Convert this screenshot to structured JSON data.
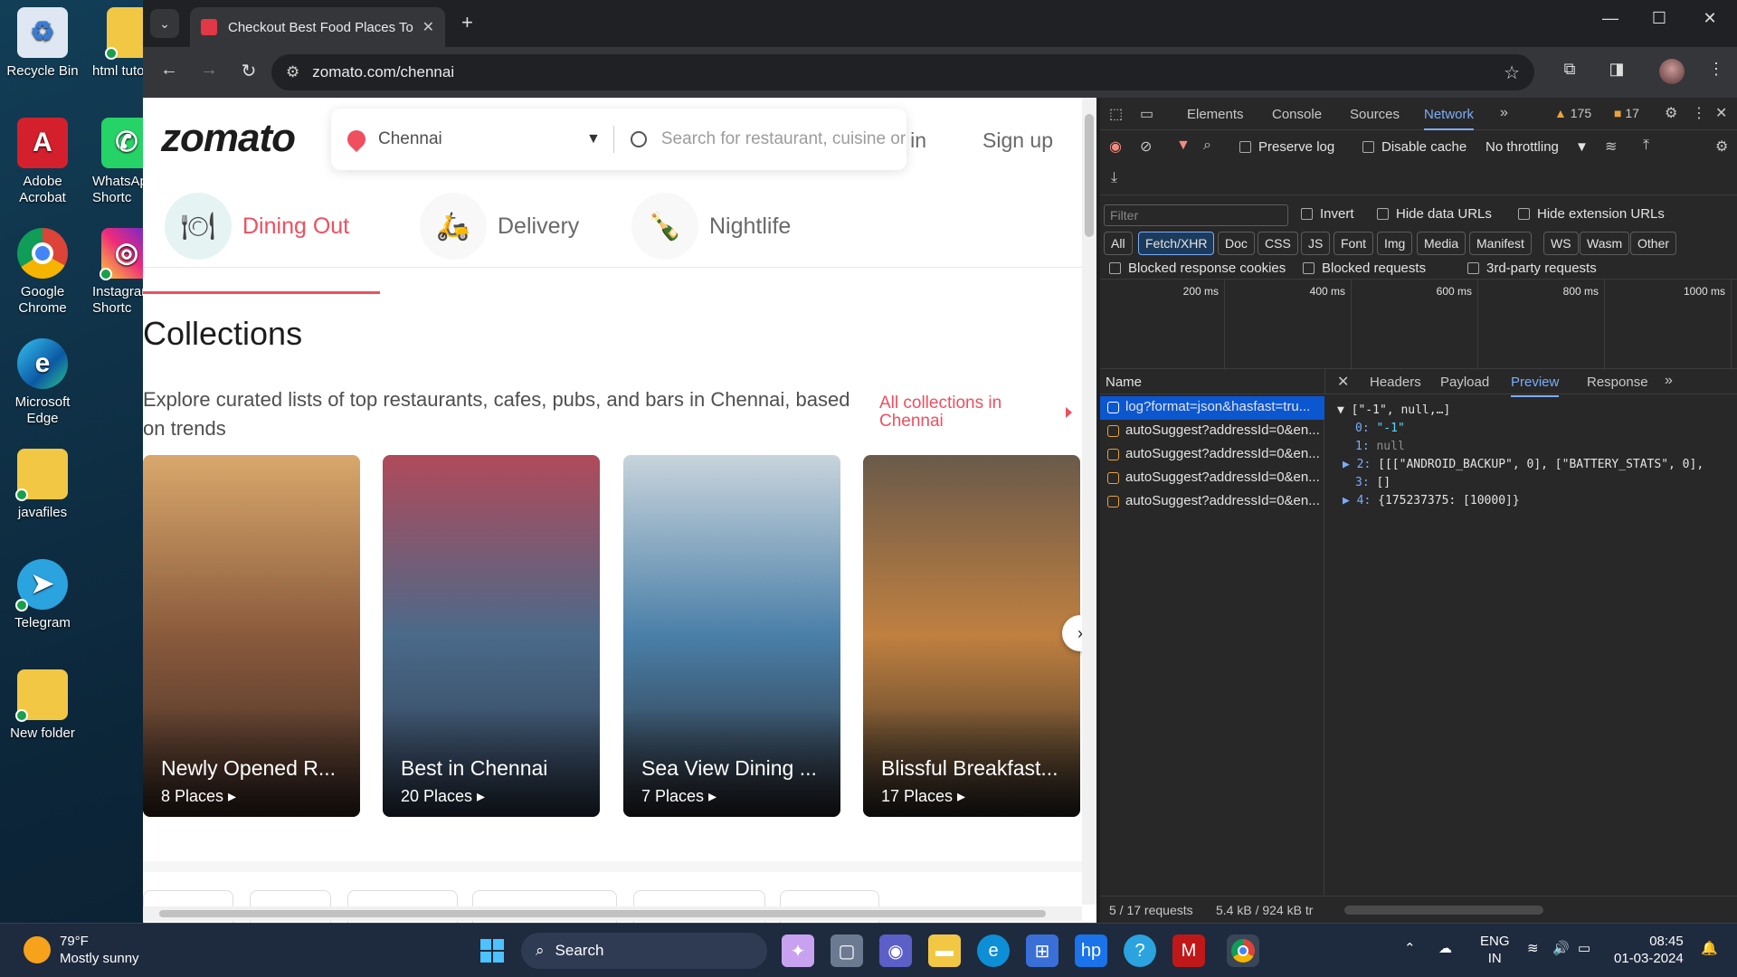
{
  "desktop": {
    "icons": [
      {
        "label": "Recycle Bin",
        "icon": "recycle-bin-icon",
        "color": "#3a7bd5"
      },
      {
        "label": "html tuto",
        "icon": "folder-icon",
        "color": "#f2c744"
      },
      {
        "label": "Adobe Acrobat",
        "icon": "acrobat-icon",
        "color": "#d4202c"
      },
      {
        "label": "WhatsApp Shortc",
        "icon": "whatsapp-icon",
        "color": "#25d366"
      },
      {
        "label": "Google Chrome",
        "icon": "chrome-icon",
        "color": "#4285f4"
      },
      {
        "label": "Instagram Shortc",
        "icon": "instagram-icon",
        "color": "#c13584"
      },
      {
        "label": "Microsoft Edge",
        "icon": "edge-icon",
        "color": "#0c8fd6"
      },
      {
        "label": "javafiles",
        "icon": "folder-icon",
        "color": "#f2c744"
      },
      {
        "label": "Telegram",
        "icon": "telegram-icon",
        "color": "#2aa3df"
      },
      {
        "label": "New folder",
        "icon": "folder-icon",
        "color": "#f2c744"
      }
    ]
  },
  "browser": {
    "tab_title": "Checkout Best Food Places To E",
    "url": "zomato.com/chennai",
    "new_tab_symbol": "+",
    "close_symbol": "✕"
  },
  "zomato": {
    "logo": "zomato",
    "location": "Chennai",
    "search_placeholder": "Search for restaurant, cuisine or a dish",
    "login": "Log in",
    "signup": "Sign up",
    "categories": [
      {
        "label": "Dining Out",
        "icon": "dining-icon",
        "active": true
      },
      {
        "label": "Delivery",
        "icon": "delivery-icon",
        "active": false
      },
      {
        "label": "Nightlife",
        "icon": "nightlife-icon",
        "active": false
      }
    ],
    "collections_title": "Collections",
    "collections_subtitle": "Explore curated lists of top restaurants, cafes, pubs, and bars in Chennai, based on trends",
    "all_collections": "All collections in Chennai",
    "cards": [
      {
        "title": "Newly Opened R...",
        "places": "8 Places ▸",
        "colors": [
          "#d9a86c",
          "#8a5a3c",
          "#3a2a24"
        ]
      },
      {
        "title": "Best in Chennai",
        "places": "20 Places ▸",
        "colors": [
          "#b04a5a",
          "#4a6a8a",
          "#2e3a4e"
        ]
      },
      {
        "title": "Sea View Dining ...",
        "places": "7 Places ▸",
        "colors": [
          "#c8d4dc",
          "#4a7fa8",
          "#2a2a30"
        ]
      },
      {
        "title": "Blissful Breakfast...",
        "places": "17 Places ▸",
        "colors": [
          "#6a5a4a",
          "#c08040",
          "#2e2a26"
        ]
      }
    ],
    "accent": "#ef4f5f"
  },
  "devtools": {
    "tabs": [
      "Elements",
      "Console",
      "Sources",
      "Network"
    ],
    "active_tab": "Network",
    "warnings": "175",
    "errors": "17",
    "preserve_log": "Preserve log",
    "disable_cache": "Disable cache",
    "throttling": "No throttling",
    "filter_placeholder": "Filter",
    "invert": "Invert",
    "hide_data_urls": "Hide data URLs",
    "hide_extension_urls": "Hide extension URLs",
    "chips": [
      "All",
      "Fetch/XHR",
      "Doc",
      "CSS",
      "JS",
      "Font",
      "Img",
      "Media",
      "Manifest",
      "WS",
      "Wasm",
      "Other"
    ],
    "selected_chip": "Fetch/XHR",
    "blocked_cookies": "Blocked response cookies",
    "blocked_requests": "Blocked requests",
    "third_party": "3rd-party requests",
    "timeline_ticks": [
      "200 ms",
      "400 ms",
      "600 ms",
      "800 ms",
      "1000 ms"
    ],
    "name_header": "Name",
    "requests": [
      "log?format=json&hasfast=tru...",
      "autoSuggest?addressId=0&en...",
      "autoSuggest?addressId=0&en...",
      "autoSuggest?addressId=0&en...",
      "autoSuggest?addressId=0&en..."
    ],
    "panel_tabs": [
      "Headers",
      "Payload",
      "Preview",
      "Response"
    ],
    "active_panel_tab": "Preview",
    "preview": {
      "root": "▼ [\"-1\", null,…]",
      "l0k": "0:",
      "l0v": "\"-1\"",
      "l1k": "1:",
      "l1v": "null",
      "l2k": "▶ 2:",
      "l2v": "[[[\"ANDROID_BACKUP\", 0], [\"BATTERY_STATS\", 0],",
      "l3k": "3:",
      "l3v": "[]",
      "l4k": "▶ 4:",
      "l4v": "{175237375: [10000]}"
    },
    "footer_requests": "5 / 17 requests",
    "footer_size": "5.4 kB / 924 kB tr"
  },
  "taskbar": {
    "temp": "79°F",
    "weather": "Mostly sunny",
    "search": "Search",
    "lang1": "ENG",
    "lang2": "IN",
    "time": "08:45",
    "date": "01-03-2024"
  }
}
